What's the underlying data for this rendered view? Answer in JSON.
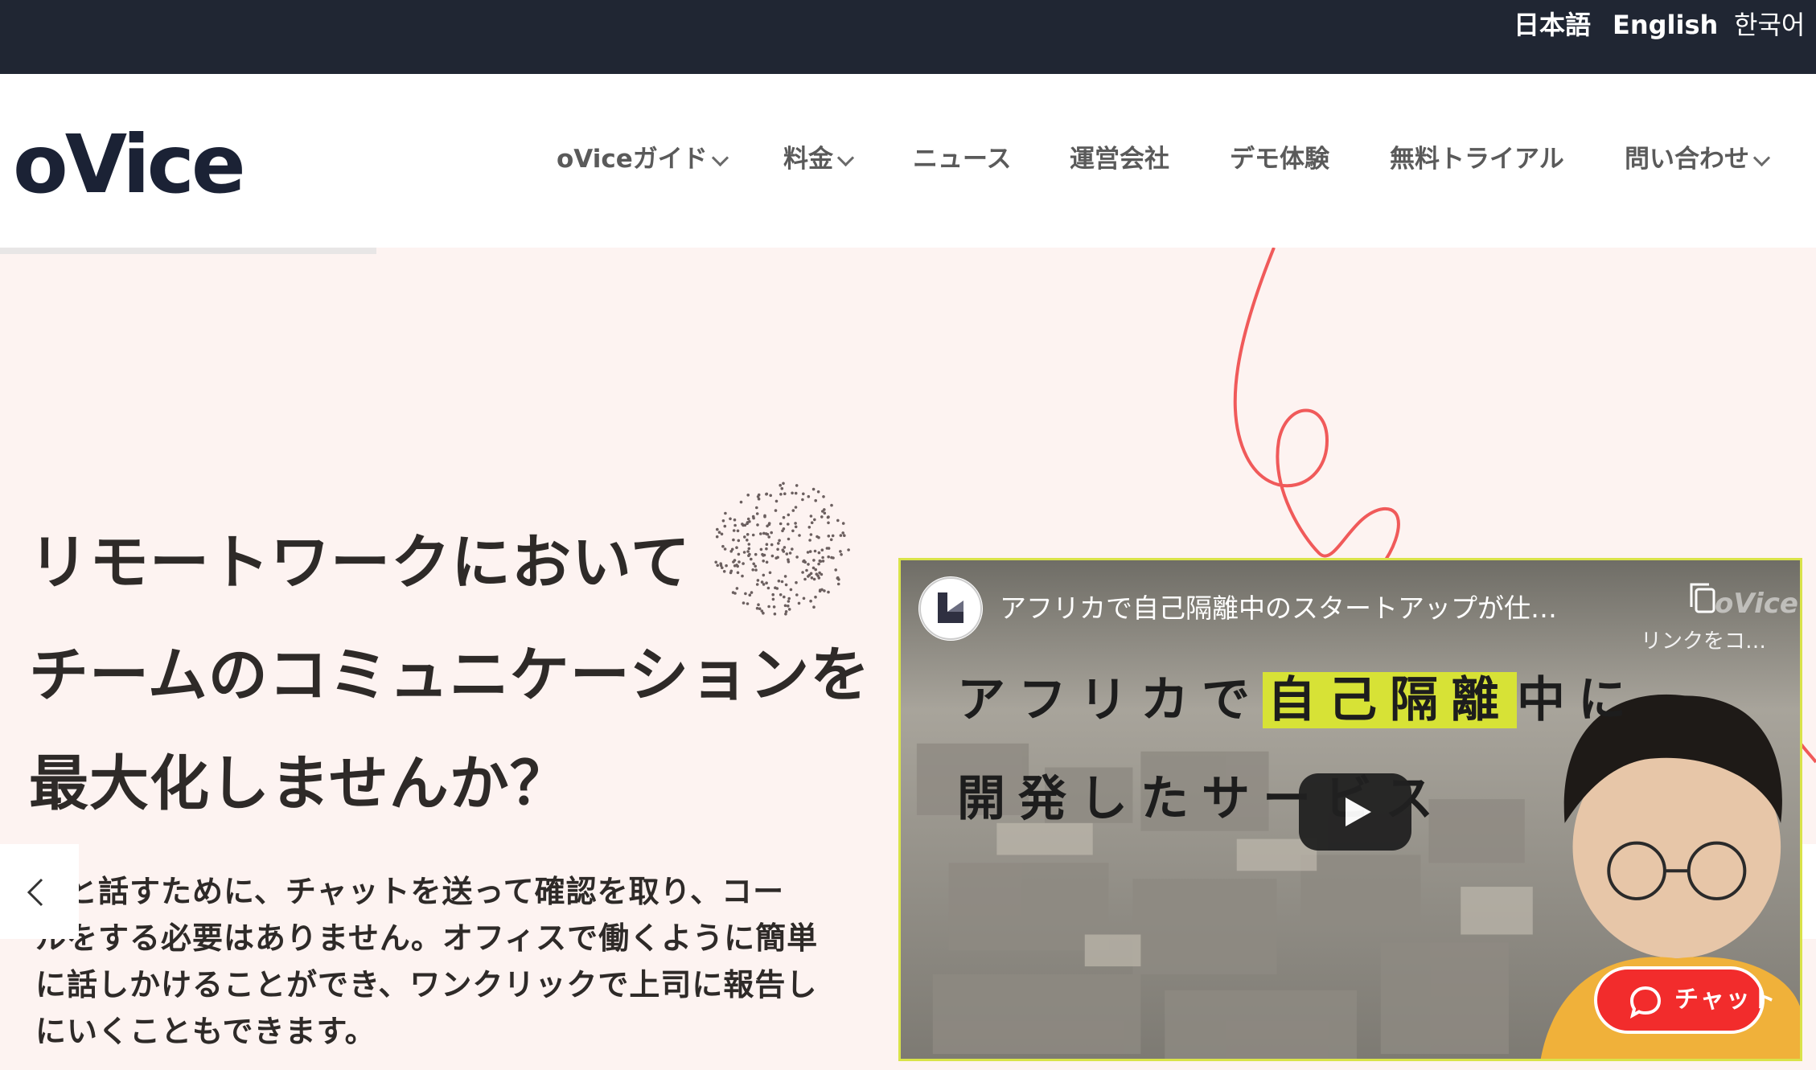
{
  "languages": [
    "日本語",
    "English",
    "한국어"
  ],
  "brand": {
    "logo_text": "oVice"
  },
  "nav": {
    "items": [
      {
        "label": "oViceガイド",
        "dropdown": true
      },
      {
        "label": "料金",
        "dropdown": true
      },
      {
        "label": "ニュース",
        "dropdown": false
      },
      {
        "label": "運営会社",
        "dropdown": false
      },
      {
        "label": "デモ体験",
        "dropdown": false
      },
      {
        "label": "無料トライアル",
        "dropdown": false
      },
      {
        "label": "問い合わせ",
        "dropdown": true
      }
    ]
  },
  "hero": {
    "headline": [
      "リモートワークにおいて",
      "チームのコミュニケーションを",
      "最大化しませんか？"
    ],
    "description": [
      "僚と話すために、チャットを送って確認を取り、コー",
      "ルをする必要はありません。オフィスで働くように簡単",
      "に話しかけることができ、ワンクリックで上司に報告し",
      "にいくこともできます。"
    ]
  },
  "video": {
    "title": "アフリカで自己隔離中のスタートアップが仕…",
    "copy_link_label": "リンクをコ…",
    "watermark": "oVice",
    "caption_line1_before": "アフリカで",
    "caption_line1_highlight": "自己隔離",
    "caption_line1_after": "中に",
    "caption_line2": "開発したサービス"
  },
  "chat": {
    "label": "チャット"
  },
  "colors": {
    "topbar": "#202633",
    "hero_bg": "#fdf3f1",
    "accent_red": "#f22c2c",
    "highlight": "#d7e236",
    "squiggle": "#f05a5a"
  },
  "icons": [
    "chevron-down-icon",
    "chevron-left-icon",
    "chevron-right-icon",
    "play-icon",
    "copy-link-icon",
    "chat-bubble-icon",
    "channel-logo-icon"
  ]
}
